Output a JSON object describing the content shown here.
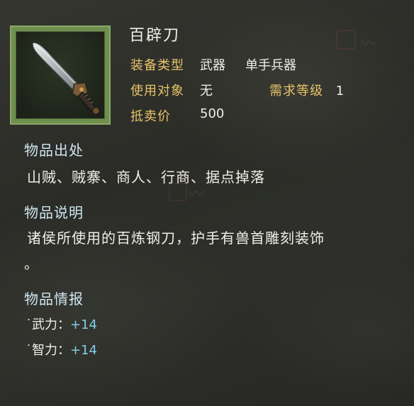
{
  "item": {
    "name": "百辟刀",
    "fields": {
      "type_label": "装备类型",
      "type_value": "武器",
      "subtype_value": "单手兵器",
      "target_label": "使用对象",
      "target_value": "无",
      "level_label": "需求等级",
      "level_value": "1",
      "price_label": "抵卖价",
      "price_value": "500"
    }
  },
  "sections": {
    "source": {
      "heading": "物品出处",
      "text": "山贼、贼寨、商人、行商、据点掉落"
    },
    "description": {
      "heading": "物品说明",
      "text_line1": "诸侯所使用的百炼钢刀，护手有兽首雕刻装饰",
      "text_line2": "。"
    },
    "info": {
      "heading": "物品情报",
      "stats": [
        {
          "label": "武力：",
          "value": "+14"
        },
        {
          "label": "智力：",
          "value": "+14"
        }
      ]
    }
  },
  "colors": {
    "label_gold": "#e6c36a",
    "heading_blue": "#cfe6f2",
    "stat_cyan": "#7fd0e6",
    "frame_green": "#6f8f4f"
  },
  "icons": [
    "saber-icon"
  ]
}
